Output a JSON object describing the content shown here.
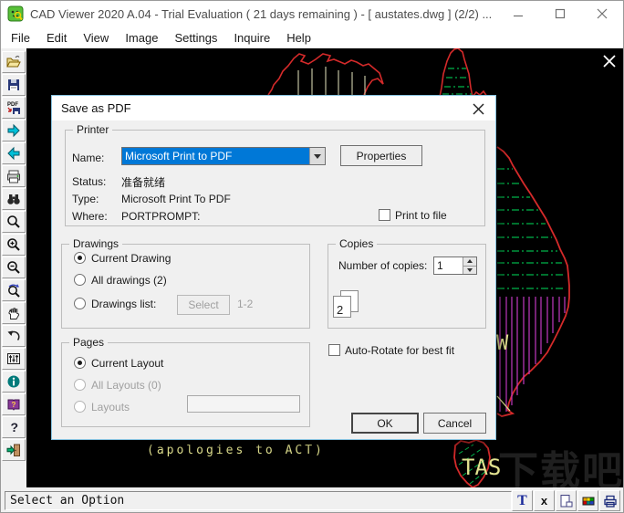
{
  "window": {
    "title": "CAD Viewer 2020 A.04 - Trial Evaluation ( 21 days remaining )  -  [ austates.dwg ] (2/2) ..."
  },
  "menu": {
    "items": [
      "File",
      "Edit",
      "View",
      "Image",
      "Settings",
      "Inquire",
      "Help"
    ]
  },
  "toolbar": {
    "pdf_label": "PDF"
  },
  "canvas": {
    "apologies_text": "(apologies to ACT)",
    "tas_label": "TAS",
    "nsw_partial_label": "W",
    "watermark": "下载吧"
  },
  "dialog": {
    "title": "Save as PDF",
    "printer": {
      "group_label": "Printer",
      "name_label": "Name:",
      "name_value": "Microsoft Print to PDF",
      "properties_label": "Properties",
      "status_label": "Status:",
      "status_value": "准备就绪",
      "type_label": "Type:",
      "type_value": "Microsoft Print To PDF",
      "where_label": "Where:",
      "where_value": "PORTPROMPT:",
      "print_to_file_label": "Print to file"
    },
    "drawings": {
      "group_label": "Drawings",
      "current_drawing_label": "Current Drawing",
      "all_drawings_label": "All drawings (2)",
      "drawings_list_label": "Drawings list:",
      "select_label": "Select",
      "range_label": "1-2"
    },
    "copies": {
      "group_label": "Copies",
      "number_label": "Number of copies:",
      "count_value": "1",
      "page_badge": "2"
    },
    "pages": {
      "group_label": "Pages",
      "current_layout_label": "Current Layout",
      "all_layouts_label": "All Layouts (0)",
      "layouts_label": "Layouts",
      "layouts_value": ""
    },
    "auto_rotate_label": "Auto-Rotate for best fit",
    "ok_label": "OK",
    "cancel_label": "Cancel"
  },
  "statusbar": {
    "message": "Select an Option",
    "text_button_label": "T",
    "x_button_label": "x"
  },
  "colors": {
    "outline_red": "#d42a2a",
    "hatch_green": "#00b44a",
    "hatch_magenta": "#c23ac2",
    "hatch_pale": "#e8e8c0",
    "cad_text_yellow": "#e2e290",
    "selection_blue": "#0078d7",
    "info_teal": "#007a7a"
  }
}
